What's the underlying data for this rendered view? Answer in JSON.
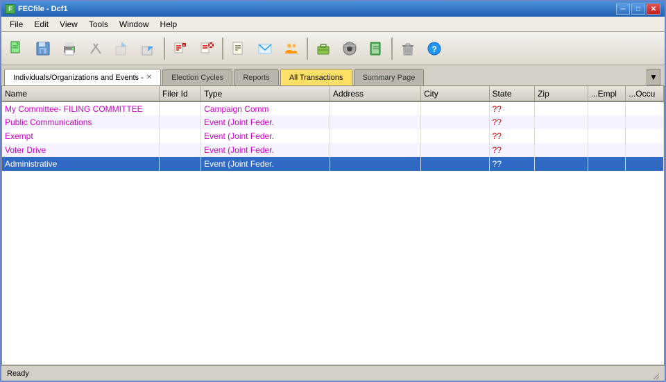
{
  "window": {
    "title": "FECfile - Dcf1",
    "icon": "F"
  },
  "titlebar": {
    "minimize": "─",
    "maximize": "□",
    "close": "✕"
  },
  "menu": {
    "items": [
      "File",
      "Edit",
      "View",
      "Tools",
      "Window",
      "Help"
    ]
  },
  "toolbar": {
    "buttons": [
      {
        "name": "new-button",
        "icon": "📄"
      },
      {
        "name": "save-button",
        "icon": "💾"
      },
      {
        "name": "print-button",
        "icon": "🖨"
      },
      {
        "name": "cut-button",
        "icon": "✂"
      },
      {
        "name": "export-button",
        "icon": "📤"
      },
      {
        "name": "import-button",
        "icon": "📥"
      },
      {
        "name": "edit-button",
        "icon": "✏"
      },
      {
        "name": "delete-button",
        "icon": "❌"
      },
      {
        "name": "report-button",
        "icon": "📋"
      },
      {
        "name": "mail-button",
        "icon": "✉"
      },
      {
        "name": "persons-button",
        "icon": "👥"
      },
      {
        "name": "briefcase-button",
        "icon": "💼"
      },
      {
        "name": "disk-button",
        "icon": "💿"
      },
      {
        "name": "book-button",
        "icon": "📖"
      },
      {
        "name": "trash-button",
        "icon": "🗑"
      },
      {
        "name": "help-button",
        "icon": "❓"
      }
    ]
  },
  "tabs": [
    {
      "id": "indiv",
      "label": "Individuals/Organizations and Events -",
      "closable": true,
      "active": true
    },
    {
      "id": "election",
      "label": "Election Cycles",
      "closable": false,
      "highlight": false
    },
    {
      "id": "reports",
      "label": "Reports",
      "closable": false,
      "highlight": false
    },
    {
      "id": "transactions",
      "label": "All Transactions",
      "closable": false,
      "highlight": true
    },
    {
      "id": "summary",
      "label": "Summary Page",
      "closable": false,
      "highlight": false
    }
  ],
  "table": {
    "columns": [
      {
        "key": "name",
        "label": "Name"
      },
      {
        "key": "filerid",
        "label": "Filer Id"
      },
      {
        "key": "type",
        "label": "Type"
      },
      {
        "key": "address",
        "label": "Address"
      },
      {
        "key": "city",
        "label": "City"
      },
      {
        "key": "state",
        "label": "State"
      },
      {
        "key": "zip",
        "label": "Zip"
      },
      {
        "key": "empl",
        "label": "...Empl"
      },
      {
        "key": "occu",
        "label": "...Occu"
      }
    ],
    "rows": [
      {
        "name": "My Committee- FILING COMMITTEE",
        "filerid": "",
        "type": "Campaign Comm",
        "address": "",
        "city": "",
        "state": "??",
        "zip": "",
        "empl": "",
        "occu": "",
        "color": "magenta",
        "selected": false
      },
      {
        "name": "Public Communications",
        "filerid": "",
        "type": "Event (Joint Feder.",
        "address": "",
        "city": "",
        "state": "??",
        "zip": "",
        "empl": "",
        "occu": "",
        "color": "magenta",
        "selected": false
      },
      {
        "name": "Exempt",
        "filerid": "",
        "type": "Event (Joint Feder.",
        "address": "",
        "city": "",
        "state": "??",
        "zip": "",
        "empl": "",
        "occu": "",
        "color": "magenta",
        "selected": false
      },
      {
        "name": "Voter Drive",
        "filerid": "",
        "type": "Event (Joint Feder.",
        "address": "",
        "city": "",
        "state": "??",
        "zip": "",
        "empl": "",
        "occu": "",
        "color": "magenta",
        "selected": false
      },
      {
        "name": "Administrative",
        "filerid": "",
        "type": "Event (Joint Feder.",
        "address": "",
        "city": "",
        "state": "??",
        "zip": "",
        "empl": "",
        "occu": "",
        "color": "magenta",
        "selected": true
      }
    ]
  },
  "statusbar": {
    "text": "Ready"
  }
}
